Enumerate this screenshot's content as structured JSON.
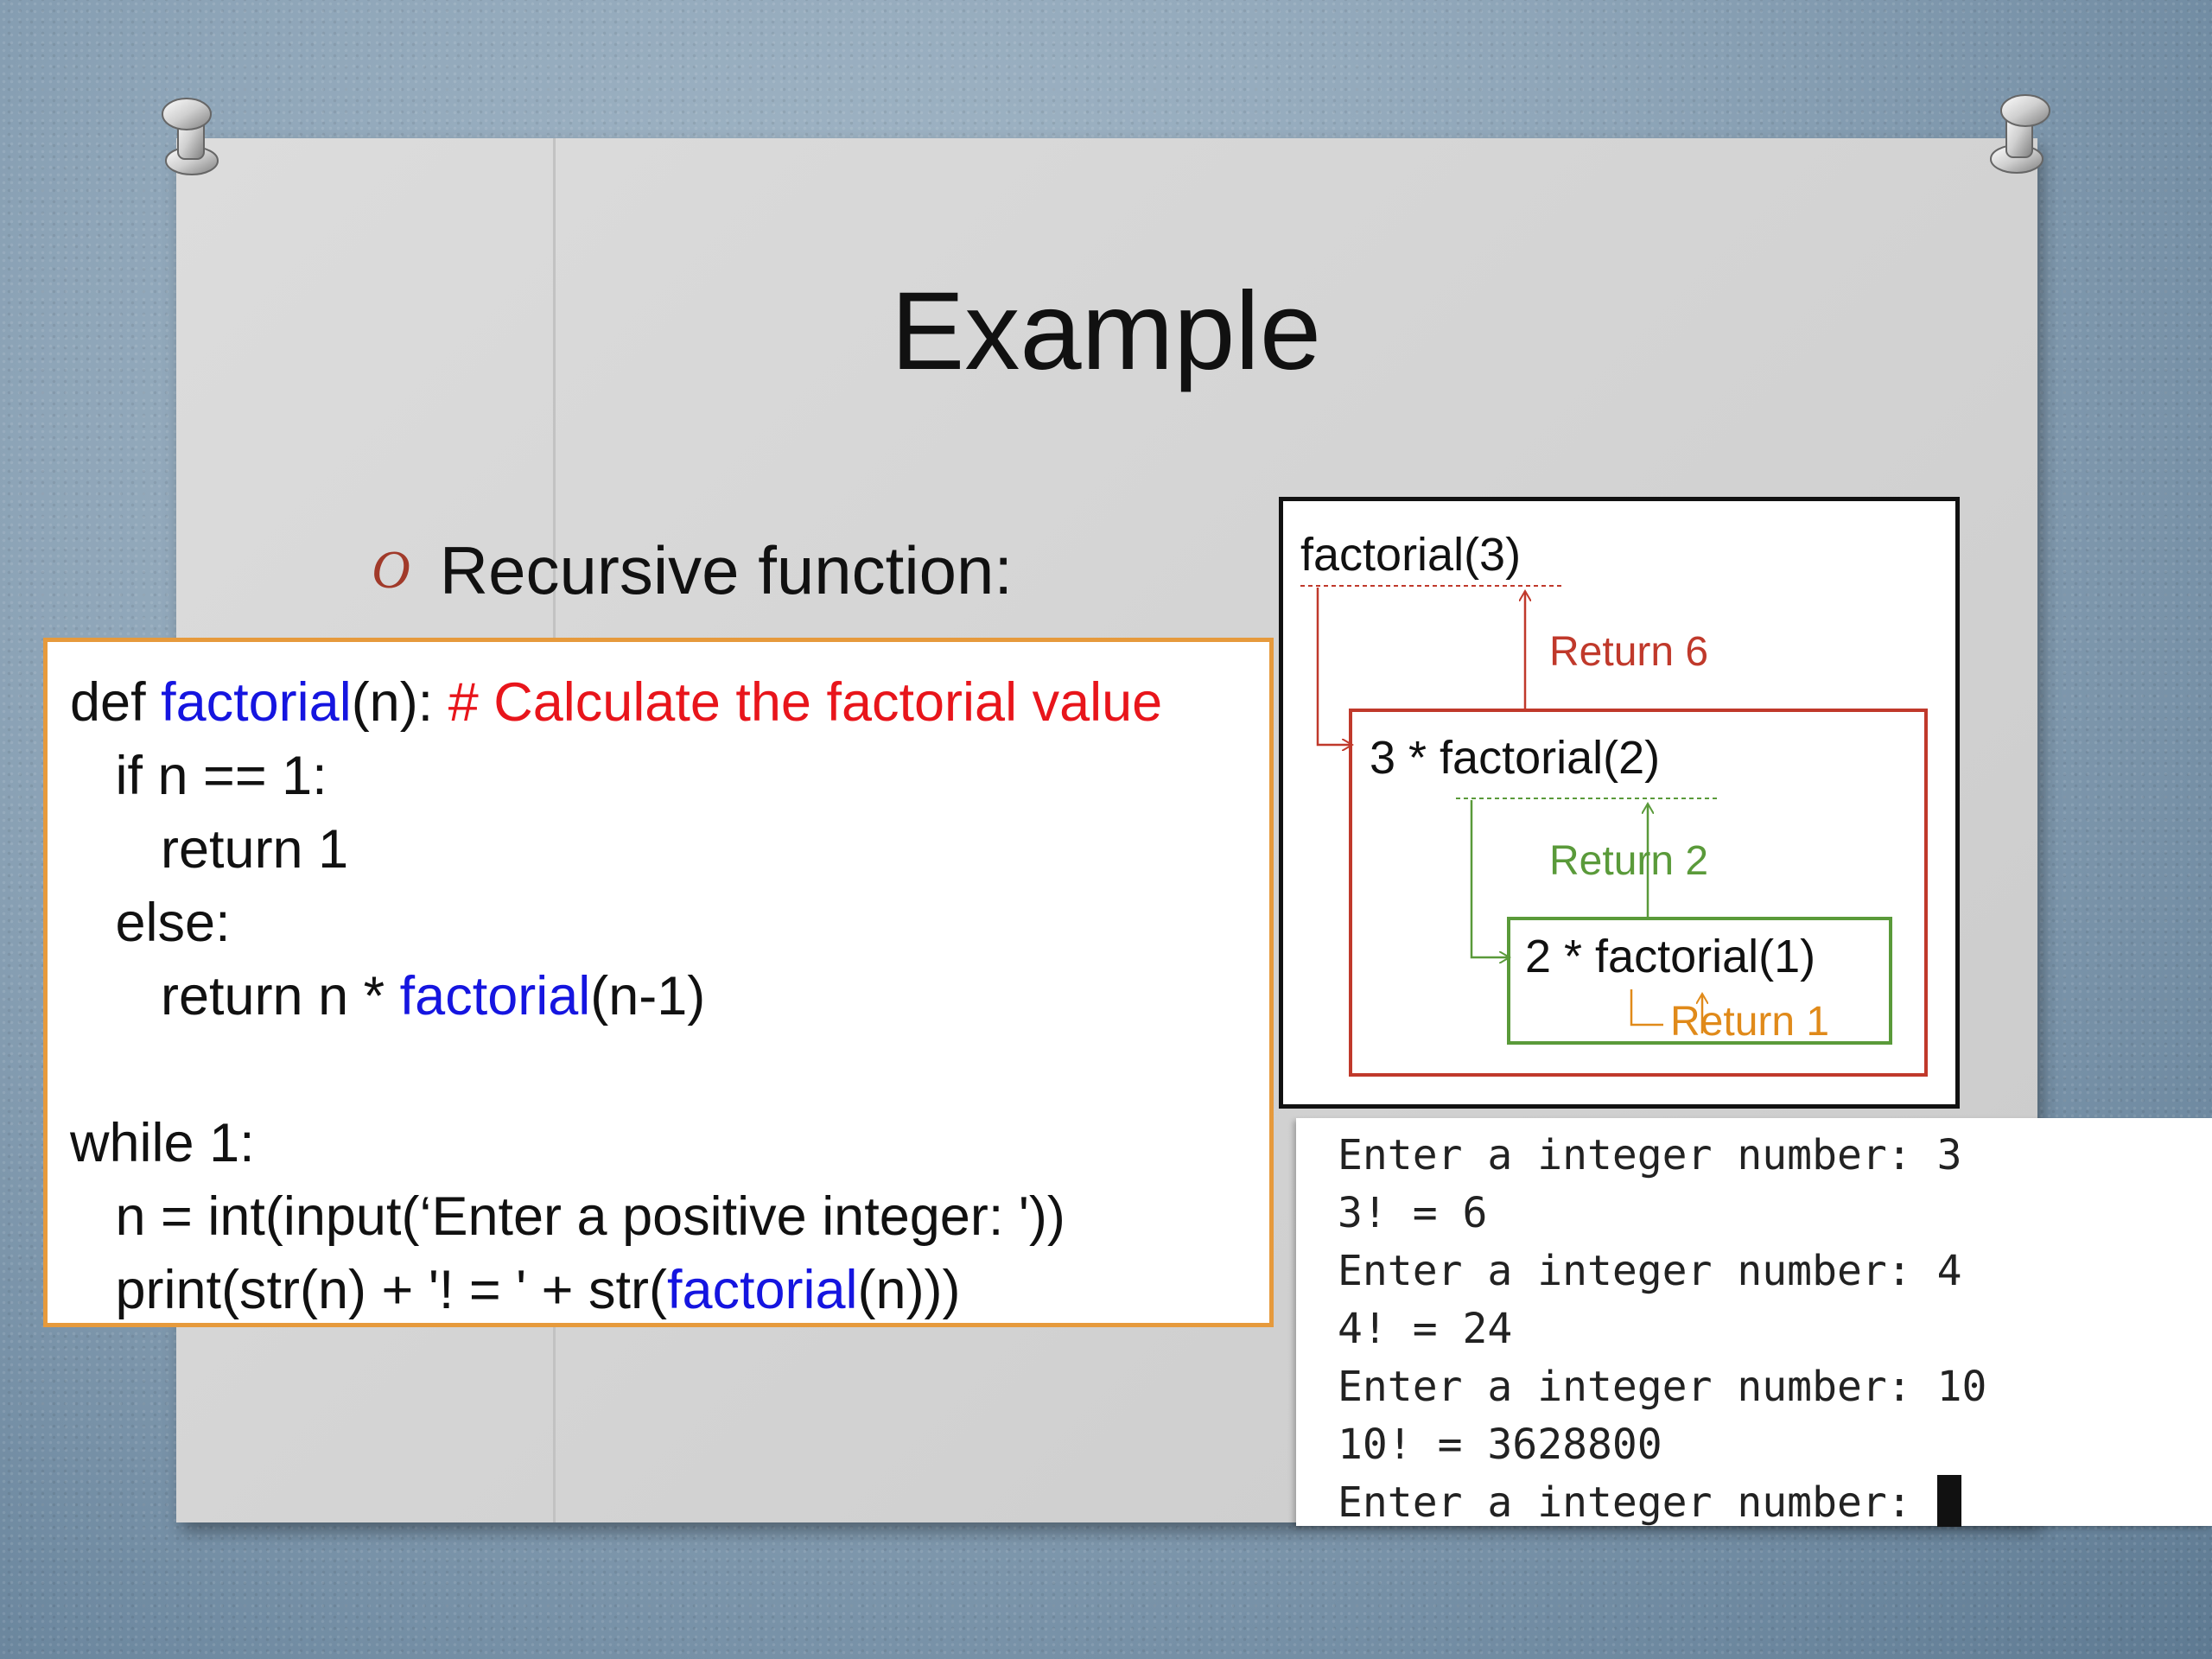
{
  "slide": {
    "title": "Example",
    "bullet_text": "Recursive function:"
  },
  "code": {
    "lines": [
      {
        "parts": [
          {
            "t": "def ",
            "c": "plain"
          },
          {
            "t": "factorial",
            "c": "blue"
          },
          {
            "t": "(n): ",
            "c": "plain"
          },
          {
            "t": "# Calculate the factorial value",
            "c": "red"
          }
        ]
      },
      {
        "parts": [
          {
            "t": "   if n == 1:",
            "c": "plain"
          }
        ]
      },
      {
        "parts": [
          {
            "t": "      return 1",
            "c": "plain"
          }
        ]
      },
      {
        "parts": [
          {
            "t": "   else:",
            "c": "plain"
          }
        ]
      },
      {
        "parts": [
          {
            "t": "      return n * ",
            "c": "plain"
          },
          {
            "t": "factorial",
            "c": "blue"
          },
          {
            "t": "(n-1)",
            "c": "plain"
          }
        ]
      },
      {
        "parts": [
          {
            "t": "",
            "c": "plain"
          }
        ]
      },
      {
        "parts": [
          {
            "t": "while 1:",
            "c": "plain"
          }
        ]
      },
      {
        "parts": [
          {
            "t": "   n = int(input(‘Enter a positive integer: '))",
            "c": "plain"
          }
        ]
      },
      {
        "parts": [
          {
            "t": "   print(str(n) + '! = ' + str(",
            "c": "plain"
          },
          {
            "t": "factorial",
            "c": "blue"
          },
          {
            "t": "(n)))",
            "c": "plain"
          }
        ]
      }
    ],
    "colors": {
      "plain": "#111111",
      "blue": "#1515e0",
      "red": "#e8151b"
    }
  },
  "diagram": {
    "outer_call": "factorial(3)",
    "return_6": "Return 6",
    "middle_call": "3 * factorial(2)",
    "return_2": "Return 2",
    "inner_call": "2 * factorial(1)",
    "return_1": "Return 1",
    "colors": {
      "red": "#c0392b",
      "green": "#5a9a3a",
      "orange": "#e08a1a"
    }
  },
  "console": {
    "lines": [
      "Enter a integer number: 3",
      "3! = 6",
      "Enter a integer number: 4",
      "4! = 24",
      "Enter a integer number: 10",
      "10! = 3628800",
      "Enter a integer number: "
    ]
  }
}
